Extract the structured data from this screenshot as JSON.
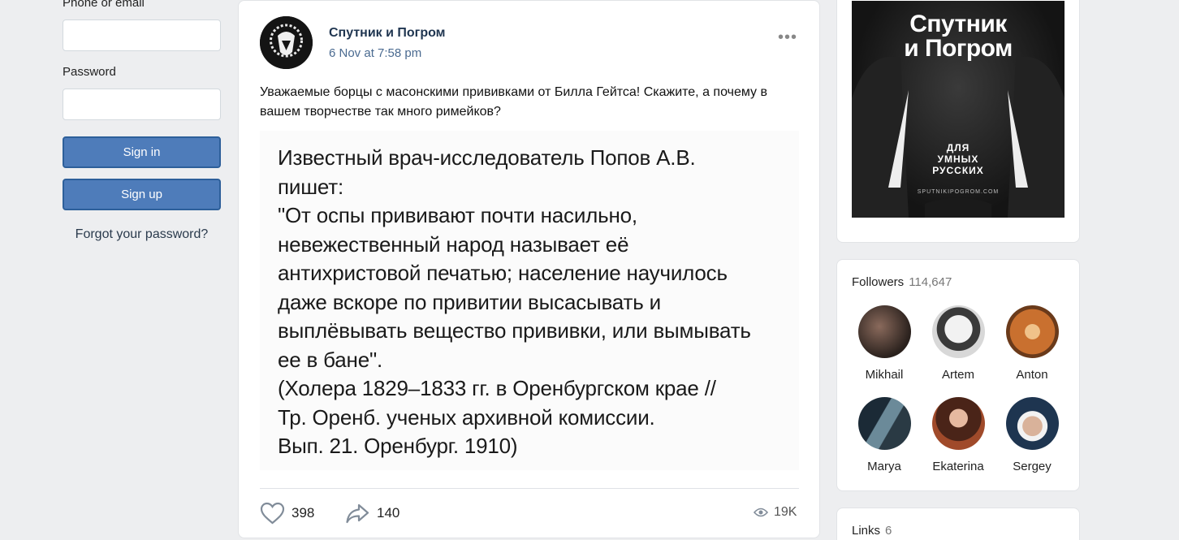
{
  "login": {
    "phone_label": "Phone or email",
    "phone_value": "",
    "password_label": "Password",
    "password_value": "",
    "signin_label": "Sign in",
    "signup_label": "Sign up",
    "forgot_label": "Forgot your password?"
  },
  "post": {
    "author": "Спутник и Погром",
    "date": "6 Nov at 7:58 pm",
    "more": "•••",
    "text": "Уважаемые борцы с масонскими прививками от Билла Гейтса! Скажите, а почему в вашем творчестве так много римейков?",
    "image_lines": [
      "Известный врач-исследователь Попов А.В.",
      "пишет:",
      "\"От оспы прививают почти насильно,",
      "невежественный народ называет её",
      "антихристовой печатью; население научилось",
      "даже вскоре по привитии высасывать и",
      "выплёвывать вещество прививки, или вымывать",
      "ее в бане\".",
      "(Холера 1829–1833 гг. в Оренбургском крае //",
      "Тр. Оренб. ученых архивной комиссии.",
      "Вып. 21. Оренбург. 1910)"
    ],
    "likes": "398",
    "shares": "140",
    "views": "19K"
  },
  "cover": {
    "title_line1": "Спутник",
    "title_line2": "и Погром",
    "subtitle_line1": "ДЛЯ",
    "subtitle_line2": "УМНЫХ",
    "subtitle_line3": "РУССКИХ",
    "url": "SPUTNIKIPOGROM.COM"
  },
  "followers": {
    "label": "Followers",
    "count": "114,647",
    "people": [
      {
        "name": "Mikhail",
        "color": "#5a4a42"
      },
      {
        "name": "Artem",
        "color": "#cfcfcf"
      },
      {
        "name": "Anton",
        "color": "#c96a2e"
      },
      {
        "name": "Marya",
        "color": "#3b5566"
      },
      {
        "name": "Ekaterina",
        "color": "#7a3a2a"
      },
      {
        "name": "Sergey",
        "color": "#2e4a6a"
      }
    ]
  },
  "links": {
    "label": "Links",
    "count": "6"
  },
  "icons": {
    "like": "heart-icon",
    "share": "share-arrow-icon",
    "views": "eye-icon",
    "more": "more-dots-icon"
  }
}
